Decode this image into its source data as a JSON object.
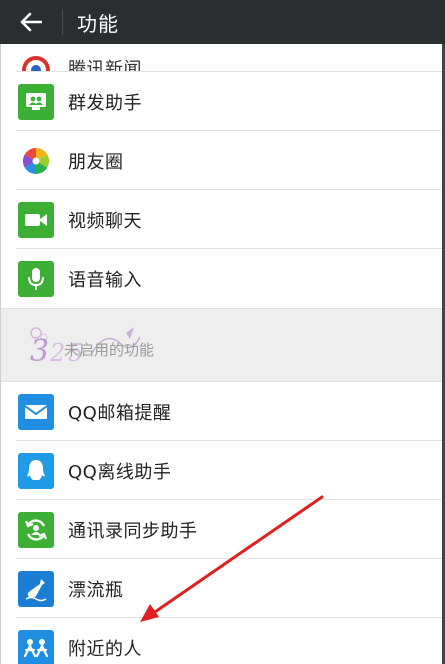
{
  "header": {
    "title": "功能",
    "back_icon": "back-arrow-icon"
  },
  "list_top": [
    {
      "label": "腾讯新闻",
      "icon": "news-icon",
      "partial": true
    },
    {
      "label": "群发助手",
      "icon": "mass-send-icon",
      "color": "#3cb034"
    },
    {
      "label": "朋友圈",
      "icon": "moments-icon"
    },
    {
      "label": "视频聊天",
      "icon": "video-chat-icon",
      "color": "#3cb034"
    },
    {
      "label": "语音输入",
      "icon": "voice-input-icon",
      "color": "#3cb034"
    }
  ],
  "section": {
    "label": "未启用的功能"
  },
  "list_bottom": [
    {
      "label": "QQ邮箱提醒",
      "icon": "mail-icon",
      "color": "#1f8ee0"
    },
    {
      "label": "QQ离线助手",
      "icon": "qq-penguin-icon",
      "color": "#1f9be8"
    },
    {
      "label": "通讯录同步助手",
      "icon": "contacts-sync-icon",
      "color": "#3cb034"
    },
    {
      "label": "漂流瓶",
      "icon": "drift-bottle-icon",
      "color": "#1a7fd4"
    },
    {
      "label": "附近的人",
      "icon": "people-nearby-icon",
      "color": "#1f8ee0"
    }
  ],
  "annotation": {
    "color": "#e02020"
  }
}
